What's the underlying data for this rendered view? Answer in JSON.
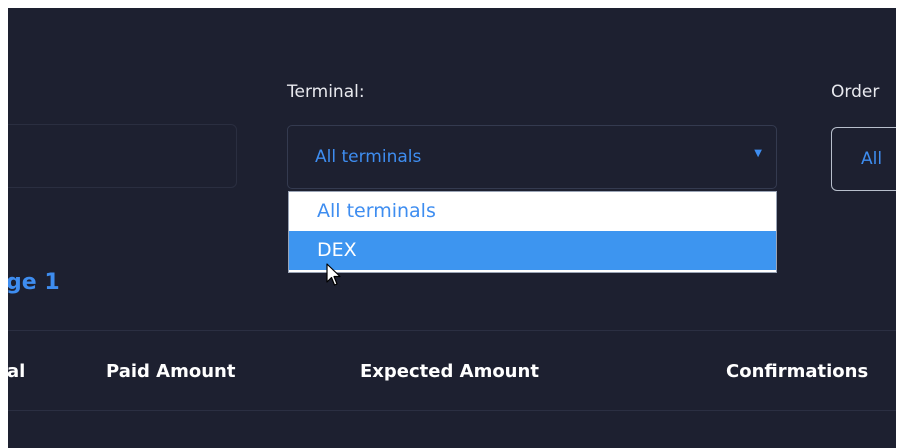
{
  "filters": {
    "terminal_label": "Terminal:",
    "terminal_value": "All terminals",
    "order_label": "Order",
    "order_value": "All"
  },
  "dropdown": {
    "options": [
      {
        "label": "All terminals",
        "selected": false
      },
      {
        "label": "DEX",
        "selected": true
      }
    ]
  },
  "section": {
    "title_fragment": "ge 1"
  },
  "table": {
    "headers": [
      "al",
      "Paid Amount",
      "Expected Amount",
      "Confirmations"
    ]
  },
  "colors": {
    "background": "#1d2030",
    "accent": "#3e8df0",
    "option_highlight": "#3d95f0"
  },
  "icons": {
    "select_caret": "caret-down-icon",
    "cursor": "mouse-pointer-icon"
  }
}
